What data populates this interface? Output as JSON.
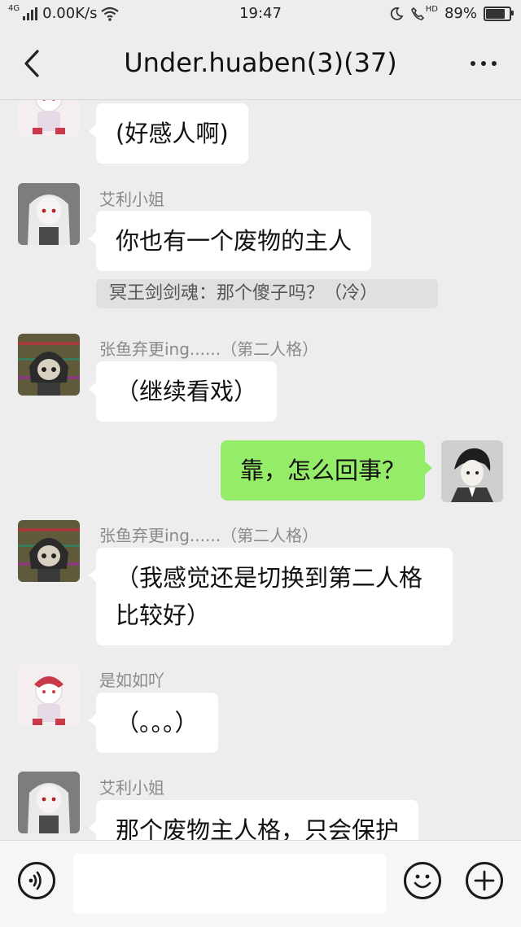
{
  "status_bar": {
    "network_type": "4G",
    "speed": "0.00K/s",
    "time": "19:47",
    "hd_label": "HD",
    "battery": "89%",
    "battery_level": 0.89,
    "icons": [
      "signal-icon",
      "wifi-icon",
      "moon-icon",
      "hd-call-icon",
      "battery-icon"
    ]
  },
  "header": {
    "title": "Under.huaben(3)(37)",
    "back_icon": "chevron-left-icon",
    "more_icon": "more-dots-icon"
  },
  "messages": [
    {
      "sender": "",
      "text": "(好感人啊)",
      "avatar": "avatar-red-hat-girl",
      "side": "left"
    },
    {
      "sender": "艾利小姐",
      "text": "你也有一个废物的主人",
      "quote": "冥王剑剑魂：那个傻子吗？（冷）",
      "avatar": "avatar-white-hair-girl",
      "side": "left"
    },
    {
      "sender": "张鱼弃更ing......（第二人格）",
      "text": "（继续看戏）",
      "avatar": "avatar-glitch-girl",
      "side": "left"
    },
    {
      "sender": "",
      "text": "靠，怎么回事？",
      "avatar": "avatar-dark-hair-boy",
      "side": "right"
    },
    {
      "sender": "张鱼弃更ing......（第二人格）",
      "text_lines": [
        "（我感觉还是切换到第二人格",
        "比较好）"
      ],
      "avatar": "avatar-glitch-girl",
      "side": "left"
    },
    {
      "sender": "是如如吖",
      "text": "（。。。）",
      "avatar": "avatar-red-hat-girl",
      "side": "left"
    },
    {
      "sender": "艾利小姐",
      "text": "那个废物主人格，只会保护",
      "avatar": "avatar-white-hair-girl",
      "side": "left"
    }
  ],
  "input_bar": {
    "placeholder": "",
    "voice_icon": "voice-icon",
    "emoji_icon": "emoji-icon",
    "add_icon": "plus-icon"
  },
  "colors": {
    "background": "#ededed",
    "own_bubble": "#95ec69",
    "other_bubble": "#ffffff",
    "nickname": "#8a8a8a"
  }
}
